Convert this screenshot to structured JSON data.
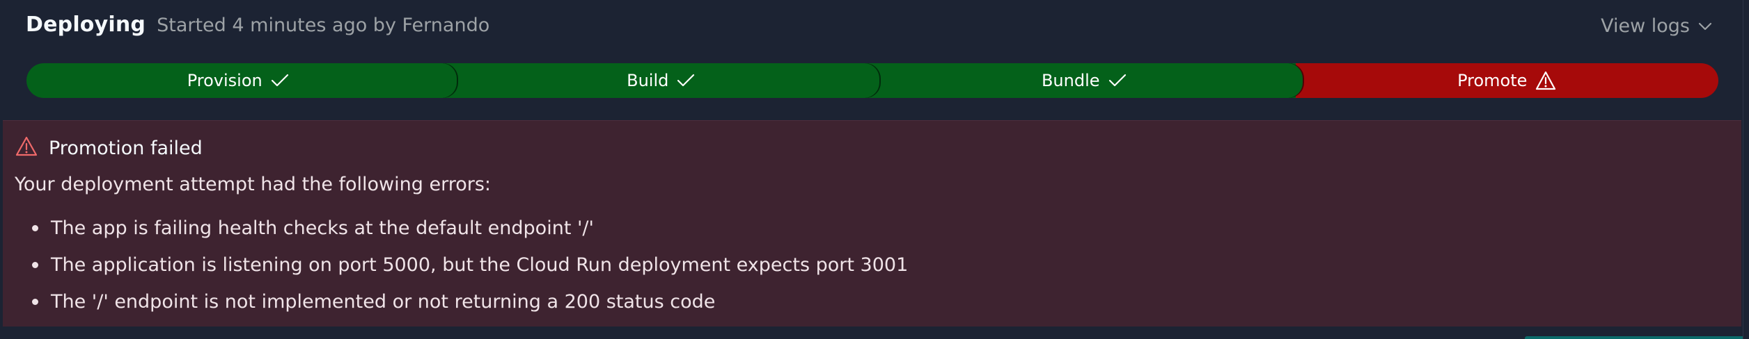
{
  "header": {
    "title": "Deploying",
    "subtitle": "Started 4 minutes ago by Fernando",
    "view_logs_label": "View logs",
    "view_logs_icon": "chevron-down-icon"
  },
  "progress": {
    "steps": [
      {
        "label": "Provision",
        "status": "success",
        "icon": "check-icon"
      },
      {
        "label": "Build",
        "status": "success",
        "icon": "check-icon"
      },
      {
        "label": "Bundle",
        "status": "success",
        "icon": "check-icon"
      },
      {
        "label": "Promote",
        "status": "error",
        "icon": "warning-icon"
      }
    ]
  },
  "error": {
    "title": "Promotion failed",
    "icon": "warning-icon",
    "intro": "Your deployment attempt had the following errors:",
    "items": [
      "The app is failing health checks at the default endpoint '/'",
      "The application is listening on port 5000, but the Cloud Run deployment expects port 3001",
      "The '/' endpoint is not implemented or not returning a 200 status code"
    ]
  },
  "colors": {
    "background": "#1c2333",
    "success": "#04611a",
    "error": "#a60a0a",
    "error_panel": "#3e2330",
    "muted_text": "#9da2a6",
    "warning_icon": "#f06a6a"
  }
}
